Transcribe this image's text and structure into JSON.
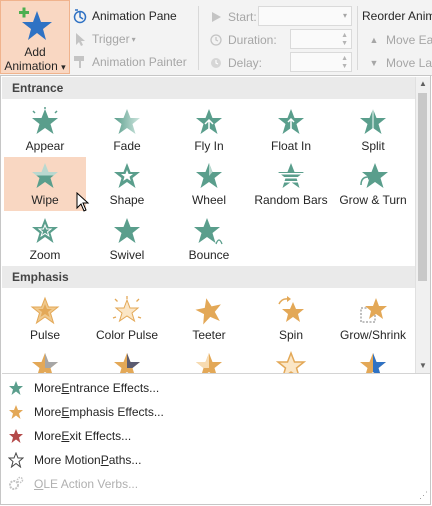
{
  "ribbon": {
    "add_animation": {
      "line1": "Add",
      "line2": "Animation",
      "arrow": "▾",
      "icon": "add-animation-star-icon"
    },
    "animation_pane": "Animation Pane",
    "trigger": "Trigger",
    "trigger_arrow": "▾",
    "animation_painter": "Animation Painter",
    "start_label": "Start:",
    "start_value": "",
    "duration_label": "Duration:",
    "duration_value": "",
    "delay_label": "Delay:",
    "delay_value": "",
    "reorder_title": "Reorder Anim",
    "move_earlier": "Move Ear",
    "move_later": "Move Lat"
  },
  "gallery": {
    "sections": {
      "entrance": "Entrance",
      "emphasis": "Emphasis"
    },
    "entrance": [
      {
        "name": "Appear"
      },
      {
        "name": "Fade"
      },
      {
        "name": "Fly In"
      },
      {
        "name": "Float In"
      },
      {
        "name": "Split"
      },
      {
        "name": "Wipe",
        "selected": true
      },
      {
        "name": "Shape"
      },
      {
        "name": "Wheel"
      },
      {
        "name": "Random Bars"
      },
      {
        "name": "Grow & Turn"
      },
      {
        "name": "Zoom"
      },
      {
        "name": "Swivel"
      },
      {
        "name": "Bounce"
      }
    ],
    "emphasis": [
      {
        "name": "Pulse"
      },
      {
        "name": "Color Pulse"
      },
      {
        "name": "Teeter"
      },
      {
        "name": "Spin"
      },
      {
        "name": "Grow/Shrink"
      }
    ]
  },
  "menu": [
    {
      "pre": "More ",
      "u": "E",
      "post": "ntrance Effects...",
      "icon": "green-star-icon",
      "color": "#5a9e8c",
      "enabled": true
    },
    {
      "pre": "More ",
      "u": "E",
      "post": "mphasis Effects...",
      "icon": "gold-star-icon",
      "color": "#e3a857",
      "enabled": true
    },
    {
      "pre": "More ",
      "u": "E",
      "post": "xit Effects...",
      "icon": "red-star-icon",
      "color": "#b44a4a",
      "enabled": true
    },
    {
      "pre": "More Motion ",
      "u": "P",
      "post": "aths...",
      "icon": "outline-star-icon",
      "color": "#444444",
      "enabled": true
    },
    {
      "pre": "",
      "u": "O",
      "post": "LE Action Verbs...",
      "icon": "ole-gears-icon",
      "color": "#b0b0b0",
      "enabled": false
    }
  ],
  "colors": {
    "entrance": "#5a9e8c",
    "emphasis": "#e3a857",
    "selected_bg": "#f9d7c2",
    "accent_blue": "#2f72c4"
  }
}
